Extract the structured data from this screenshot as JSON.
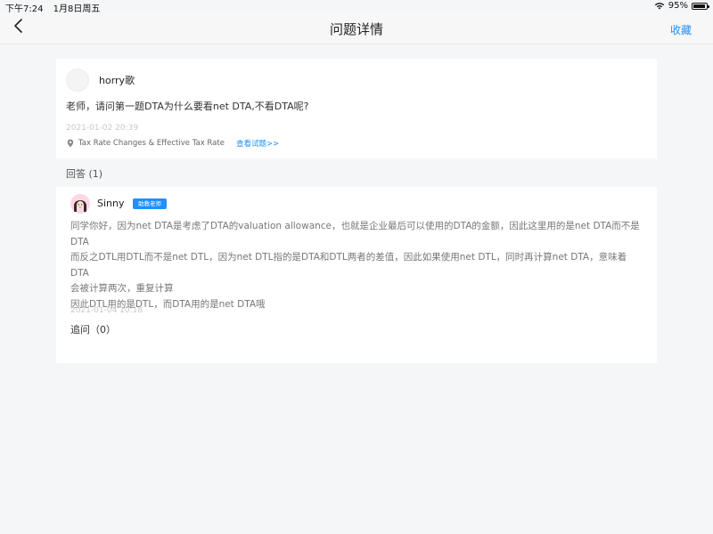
{
  "status": {
    "time": "下午7:24",
    "date": "1月8日周五",
    "battery": "95%"
  },
  "nav": {
    "title": "问题详情",
    "favorite_label": "收藏"
  },
  "question": {
    "username": "horry歌",
    "text": "老师，请问第一题DTA为什么要看net DTA,不看DTA呢?",
    "date": "2021-01-02 20:39",
    "tag": "Tax Rate Changes & Effective Tax Rate",
    "view_link": "查看试题>>"
  },
  "answers_heading": "回答 (1)",
  "answer": {
    "name": "Sinny",
    "badge": "助教老师",
    "lines": [
      "同学你好，因为net DTA是考虑了DTA的valuation allowance，也就是企业最后可以使用的DTA的金额，因此这里用的是net DTA而不是",
      "DTA",
      "而反之DTL用DTL而不是net DTL，因为net DTL指的是DTA和DTL两者的差值，因此如果使用net DTL，同时再计算net DTA，意味着DTA",
      "会被计算两次，重复计算",
      "因此DTL用的是DTL，而DTA用的是net DTA哦"
    ],
    "date": "2021-01-04 10:18",
    "followup": "追问（0）"
  },
  "colors": {
    "accent": "#1e90ff",
    "background": "#f5f6f8",
    "card": "#ffffff",
    "muted_text": "#777777",
    "date_text": "#c8c8c8"
  }
}
